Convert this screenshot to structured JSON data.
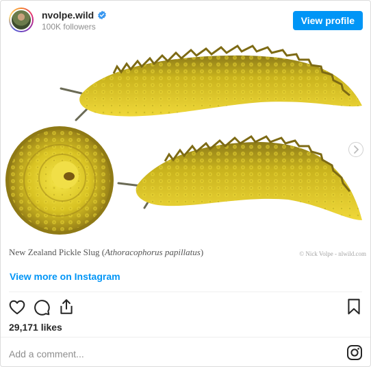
{
  "header": {
    "username": "nvolpe.wild",
    "followers": "100K followers",
    "view_profile_label": "View profile"
  },
  "media": {
    "caption_prefix": "New Zealand Pickle Slug (",
    "caption_species": "Athoracophorus papillatus",
    "caption_suffix": ")",
    "credit": "© Nick Volpe - nlwild.com"
  },
  "view_more_label": "View more on Instagram",
  "likes": "29,171 likes",
  "comment_placeholder": "Add a comment...",
  "colors": {
    "accent": "#0095f6",
    "slug_yellow": "#d8c21a",
    "slug_dark": "#8a6a12"
  }
}
